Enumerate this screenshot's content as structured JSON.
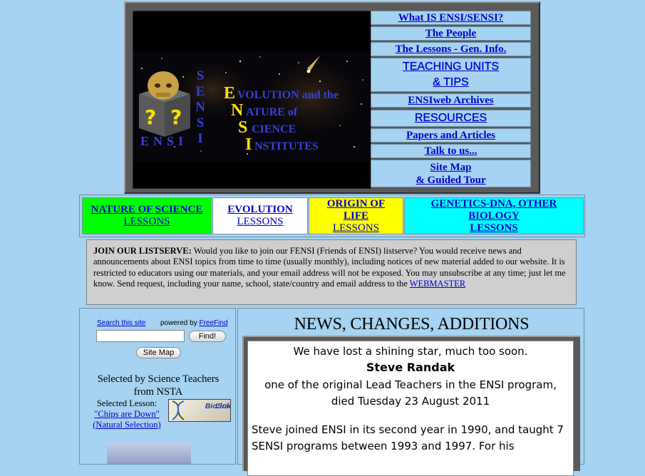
{
  "banner": {
    "logo_letters": [
      "S",
      "E",
      "N",
      "S",
      "I"
    ],
    "logo_word": "ENSI",
    "acrostic": [
      "E",
      "N",
      "S",
      "I"
    ],
    "line1": "VOLUTION and the",
    "line2": "ATURE of",
    "line3": "CIENCE",
    "line4": "NSTITUTES"
  },
  "nav": [
    "What IS ENSI/SENSI?",
    "The People",
    "The Lessons - Gen. Info.",
    "TEACHING UNITS",
    "& TIPS",
    "ENSIweb Archives",
    "RESOURCES",
    "Papers and Articles",
    "Talk to us...",
    "Site Map",
    "& Guided Tour"
  ],
  "lessons": [
    {
      "title": "NATURE OF SCIENCE",
      "sub": "LESSONS",
      "color": "#00ff00"
    },
    {
      "title": "EVOLUTION",
      "sub": "LESSONS",
      "color": "#ffffff"
    },
    {
      "title": "ORIGIN OF",
      "title2": "LIFE",
      "sub": "LESSONS",
      "color": "#ffff00"
    },
    {
      "title": "GENETICS-DNA, OTHER",
      "title2": "BIOLOGY",
      "sub": "LESSONS",
      "color": "#00ffff"
    }
  ],
  "listserve": {
    "heading": "JOIN OUR LISTSERVE:",
    "body": " Would you like to join our FENSI (Friends of ENSI) listserve? You would receive news and announcements about ENSI topics from time to time (usually monthly), including notices of new material added to our website. It is restricted to educators using our materials, and your email address will not be exposed. You may unsubscribe at any time; just let me know. Send request, including your name, school, state/country and email address to the ",
    "link": "WEBMASTER"
  },
  "search": {
    "link": "Search this site",
    "powered_by": "powered by ",
    "powered_link": "FreeFind",
    "input_value": "",
    "find_button": "Find!",
    "sitemap_button": "Site Map"
  },
  "selected": {
    "title_line1": "Selected by Science Teachers",
    "title_line2": "from NSTA",
    "label": "Selected Lesson:",
    "lesson_link": "\"Chips are Down\"",
    "lesson_sub": "(Natural Selection)",
    "badge_line1": "BioScience",
    "badge_line2": "Links"
  },
  "news": {
    "title": "NEWS, CHANGES, ADDITIONS",
    "line1": "We have lost a shining star, much too soon.",
    "name": "Steve Randak",
    "line3": "one of the original Lead Teachers in the ENSI program,",
    "line4": "died Tuesday 23 August 2011",
    "para_line1": "Steve joined ENSI in its second year in 1990, and taught 7",
    "para_line2": "SENSI programs between 1993 and 1997. For his"
  }
}
